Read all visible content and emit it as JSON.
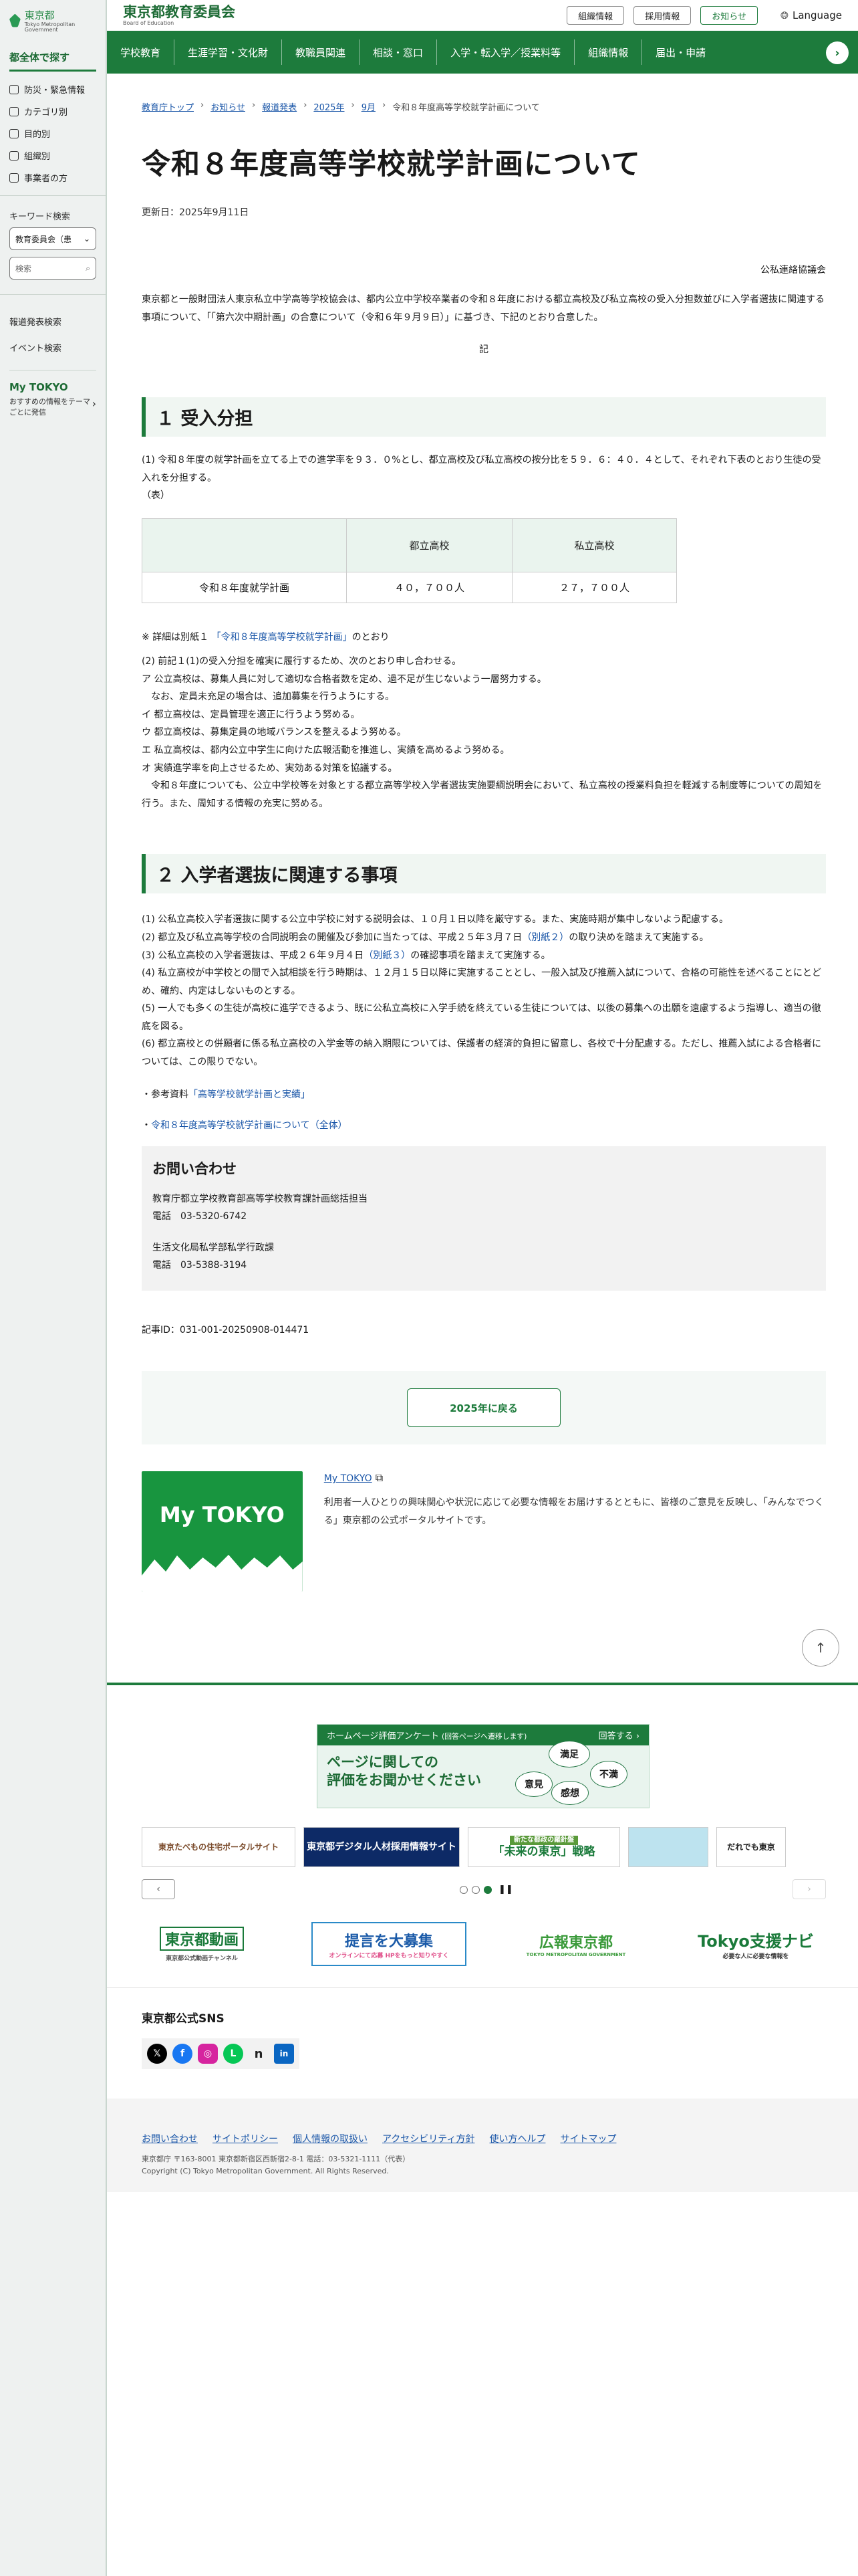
{
  "sidebar": {
    "logo_text": "東京都",
    "logo_sub": "Tokyo Metropolitan Government",
    "heading": "都全体で探す",
    "items": [
      {
        "label": "防災・緊急情報",
        "icon": "megaphone-icon"
      },
      {
        "label": "カテゴリ別",
        "icon": "folder-icon"
      },
      {
        "label": "目的別",
        "icon": "target-icon"
      },
      {
        "label": "組織別",
        "icon": "building-icon"
      },
      {
        "label": "事業者の方",
        "icon": "briefcase-icon"
      }
    ],
    "keyword_label": "キーワード検索",
    "select_value": "教育委員会（患",
    "search_placeholder": "検索",
    "links": [
      "報道発表検索",
      "イベント検索"
    ],
    "mytokyo_title": "My TOKYO",
    "mytokyo_desc": "おすすめの情報をテーマごとに発信"
  },
  "header": {
    "title": "東京都教育委員会",
    "subtitle": "Board of Education",
    "buttons": [
      "組織情報",
      "採用情報",
      "お知らせ"
    ],
    "language": "Language"
  },
  "gnav": [
    "学校教育",
    "生涯学習・文化財",
    "教職員関連",
    "相談・窓口",
    "入学・転入学／授業料等",
    "組織情報",
    "届出・申請"
  ],
  "breadcrumb": [
    "教育庁トップ",
    "お知らせ",
    "報道発表",
    "2025年",
    "9月",
    "令和８年度高等学校就学計画について"
  ],
  "page": {
    "title": "令和８年度高等学校就学計画について",
    "updated": "更新日：2025年9月11日",
    "org_right": "公私連絡協議会",
    "intro": "東京都と一般財団法人東京私立中学高等学校協会は、都内公立中学校卒業者の令和８年度における都立高校及び私立高校の受入分担数並びに入学者選抜に関連する事項について、「「第六次中期計画」の合意について（令和６年９月９日）」に基づき、下記のとおり合意した。",
    "ki": "記"
  },
  "section1": {
    "title": "１ 受入分担",
    "para": "(1) 令和８年度の就学計画を立てる上での進学率を９３．０%とし、都立高校及び私立高校の按分比を５９．６：４０．４として、それぞれ下表のとおり生徒の受入れを分担する。",
    "table_caption": "（表）",
    "table": {
      "headers": [
        "",
        "都立高校",
        "私立高校"
      ],
      "rows": [
        [
          "令和８年度就学計画",
          "４０，７００人",
          "２７，７００人"
        ]
      ]
    },
    "note_prefix": "※ 詳細は別紙１",
    "note_link": "「令和８年度高等学校就学計画」",
    "note_suffix": "のとおり",
    "lines": [
      "(2) 前記１(1)の受入分担を確実に履行するため、次のとおり申し合わせる。",
      "ア 公立高校は、募集人員に対して適切な合格者数を定め、過不足が生じないよう一層努力する。",
      "　なお、定員未充足の場合は、追加募集を行うようにする。",
      "イ 都立高校は、定員管理を適正に行うよう努める。",
      "ウ 都立高校は、募集定員の地域バランスを整えるよう努める。",
      "エ 私立高校は、都内公立中学生に向けた広報活動を推進し、実績を高めるよう努める。",
      "オ 実績進学率を向上させるため、実効ある対策を協議する。",
      "　令和８年度についても、公立中学校等を対象とする都立高等学校入学者選抜実施要綱説明会において、私立高校の授業料負担を軽減する制度等についての周知を行う。また、周知する情報の充実に努める。"
    ]
  },
  "section2": {
    "title": "２ 入学者選抜に関連する事項",
    "lines": [
      {
        "text": "(1) 公私立高校入学者選抜に関する公立中学校に対する説明会は、１０月１日以降を厳守する。また、実施時期が集中しないよう配慮する。"
      },
      {
        "text": "(2) 都立及び私立高等学校の合同説明会の開催及び参加に当たっては、平成２５年３月７日",
        "link": "（別紙２）",
        "after": "の取り決めを踏まえて実施する。"
      },
      {
        "text": "(3) 公私立高校の入学者選抜は、平成２６年９月４日",
        "link": "（別紙３）",
        "after": "の確認事項を踏まえて実施する。"
      },
      {
        "text": "(4) 私立高校が中学校との間で入試相談を行う時期は、１２月１５日以降に実施することとし、一般入試及び推薦入試について、合格の可能性を述べることにとどめ、確約、内定はしないものとする。"
      },
      {
        "text": "(5) 一人でも多くの生徒が高校に進学できるよう、既に公私立高校に入学手続を終えている生徒については、以後の募集への出願を遠慮するよう指導し、適当の徹底を図る。"
      },
      {
        "text": "(6) 都立高校との併願者に係る私立高校の入学金等の納入期限については、保護者の経済的負担に留意し、各校で十分配慮する。ただし、推薦入試による合格者については、この限りでない。"
      }
    ],
    "ref1_prefix": "・参考資料",
    "ref1_link": "「高等学校就学計画と実績」",
    "ref2_link": "令和８年度高等学校就学計画について（全体）"
  },
  "contact": {
    "title": "お問い合わせ",
    "entries": [
      {
        "dept": "教育庁都立学校教育部高等学校教育課計画総括担当",
        "tel": "電話　03-5320-6742"
      },
      {
        "dept": "生活文化局私学部私学行政課",
        "tel": "電話　03-5388-3194"
      }
    ]
  },
  "article_id": "記事ID：031-001-20250908-014471",
  "back_button": "2025年に戻る",
  "mytokyo": {
    "image_text": "My TOKYO",
    "link": "My TOKYO",
    "desc": "利用者一人ひとりの興味関心や状況に応じて必要な情報をお届けするとともに、皆様のご意見を反映し、「みんなでつくる」東京都の公式ポータルサイトです。"
  },
  "survey": {
    "bar_left": "ホームページ評価アンケート",
    "bar_note": "(回答ページへ遷移します)",
    "bar_right": "回答する ›",
    "line1": "ページに関しての",
    "line2": "評価をお聞かせください",
    "bubbles": [
      "満足",
      "意見",
      "感想",
      "不満"
    ]
  },
  "banners": [
    "東京たべもの住宅ポータルサイト",
    "東京都デジタル人材採用情報サイト",
    "「未来の東京」戦略",
    "",
    "だれでも東京"
  ],
  "banner_sub": "新たな都政の羅針盤",
  "carousel": {
    "prev": "‹",
    "next": "›",
    "pause": "❚❚"
  },
  "logos": [
    {
      "title": "東京都動画",
      "sub": "東京都公式動画チャンネル"
    },
    {
      "title": "提言を大募集",
      "sub": "オンラインにて応募 HPをもっと知りやすく"
    },
    {
      "title": "広報東京都",
      "sub": "TOKYO METROPOLITAN GOVERNMENT"
    },
    {
      "title": "Tokyo支援ナビ",
      "sub": "必要な人に必要な情報を"
    }
  ],
  "sns_title": "東京都公式SNS",
  "sns": [
    {
      "icon": "x-icon",
      "glyph": "𝕏",
      "color": "#000000"
    },
    {
      "icon": "facebook-icon",
      "glyph": "f",
      "color": "#1877f2"
    },
    {
      "icon": "instagram-icon",
      "glyph": "◎",
      "color": "#d6249f"
    },
    {
      "icon": "line-icon",
      "glyph": "L",
      "color": "#06c755"
    },
    {
      "icon": "note-icon",
      "glyph": "n",
      "color": "#222222"
    },
    {
      "icon": "linkedin-icon",
      "glyph": "in",
      "color": "#0a66c2"
    }
  ],
  "footer_links": [
    "お問い合わせ",
    "サイトポリシー",
    "個人情報の取扱い",
    "アクセシビリティ方針",
    "使い方ヘルプ",
    "サイトマップ"
  ],
  "footer_addr": "東京都庁 〒163-8001 東京都新宿区西新宿2-8-1 電話：03-5321-1111（代表）",
  "copyright": "Copyright (C) Tokyo Metropolitan Government. All Rights Reserved.",
  "colors": {
    "brand": "#1d7b3c",
    "link": "#1a56a8"
  }
}
